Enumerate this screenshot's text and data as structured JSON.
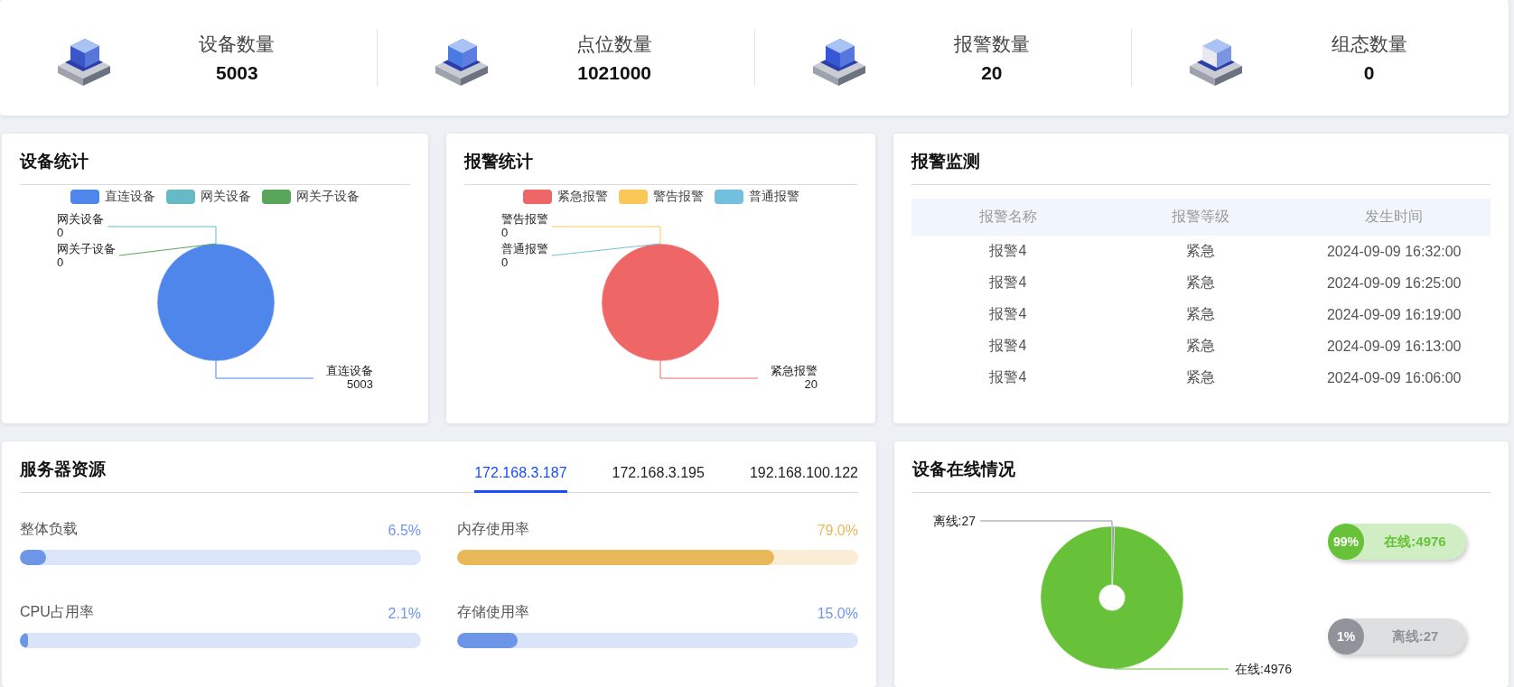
{
  "stats": [
    {
      "label": "设备数量",
      "value": "5003"
    },
    {
      "label": "点位数量",
      "value": "1021000"
    },
    {
      "label": "报警数量",
      "value": "20"
    },
    {
      "label": "组态数量",
      "value": "0"
    }
  ],
  "device_stats": {
    "title": "设备统计",
    "legend": [
      {
        "label": "直连设备",
        "color": "#4f86ec"
      },
      {
        "label": "网关设备",
        "color": "#65bac6"
      },
      {
        "label": "网关子设备",
        "color": "#58a55c"
      }
    ],
    "chart_data": {
      "type": "pie",
      "categories": [
        "直连设备",
        "网关设备",
        "网关子设备"
      ],
      "values": [
        5003,
        0,
        0
      ],
      "value_labels": [
        "5003",
        "0",
        "0"
      ]
    }
  },
  "alarm_stats": {
    "title": "报警统计",
    "legend": [
      {
        "label": "紧急报警",
        "color": "#ee6666"
      },
      {
        "label": "警告报警",
        "color": "#fac858"
      },
      {
        "label": "普通报警",
        "color": "#73c0de"
      }
    ],
    "chart_data": {
      "type": "pie",
      "categories": [
        "紧急报警",
        "警告报警",
        "普通报警"
      ],
      "values": [
        20,
        0,
        0
      ],
      "value_labels": [
        "20",
        "0",
        "0"
      ]
    }
  },
  "alarm_monitor": {
    "title": "报警监测",
    "columns": [
      "报警名称",
      "报警等级",
      "发生时间"
    ],
    "rows": [
      [
        "报警4",
        "紧急",
        "2024-09-09 16:32:00"
      ],
      [
        "报警4",
        "紧急",
        "2024-09-09 16:25:00"
      ],
      [
        "报警4",
        "紧急",
        "2024-09-09 16:19:00"
      ],
      [
        "报警4",
        "紧急",
        "2024-09-09 16:13:00"
      ],
      [
        "报警4",
        "紧急",
        "2024-09-09 16:06:00"
      ]
    ]
  },
  "server_resources": {
    "title": "服务器资源",
    "tabs": [
      {
        "label": "172.168.3.187",
        "selected": true
      },
      {
        "label": "172.168.3.195",
        "selected": false
      },
      {
        "label": "192.168.100.122",
        "selected": false
      }
    ],
    "metrics": [
      {
        "label": "整体负载",
        "reading": "6.5%",
        "level": 0.065,
        "color": "#6d96e8"
      },
      {
        "label": "内存使用率",
        "reading": "79.0%",
        "level": 0.79,
        "color": "#e9b858"
      },
      {
        "label": "CPU占用率",
        "reading": "2.1%",
        "level": 0.021,
        "color": "#6d96e8"
      },
      {
        "label": "存储使用率",
        "reading": "15.0%",
        "level": 0.15,
        "color": "#6d96e8"
      }
    ]
  },
  "online": {
    "title": "设备在线情况",
    "chart_data": {
      "type": "donut",
      "values": [
        4976,
        27
      ],
      "value_labels": [
        "在线:4976",
        "离线:27"
      ]
    },
    "pills": [
      {
        "percent": "99%",
        "label": "在线:4976",
        "color": "#67c23a"
      },
      {
        "percent": "1%",
        "label": "离线:27",
        "color": "#909399"
      }
    ]
  }
}
